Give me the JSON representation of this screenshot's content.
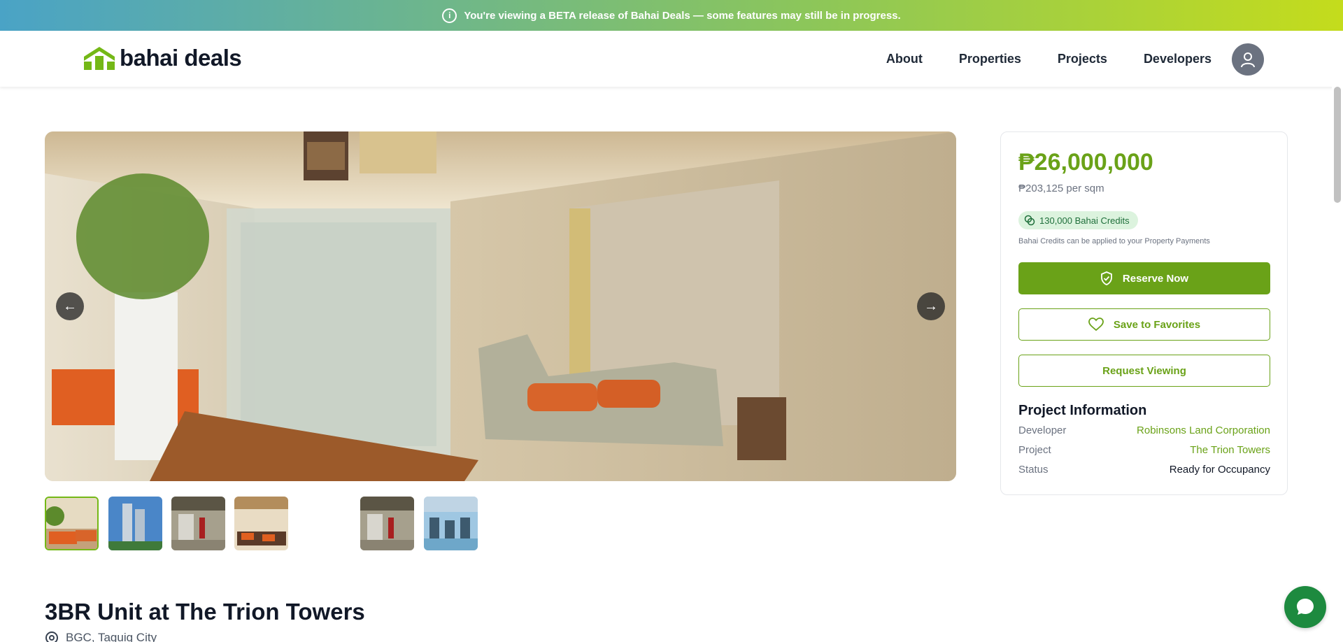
{
  "banner": {
    "text": "You're viewing a BETA release of Bahai Deals — some features may still be in progress.",
    "icon": "info-icon"
  },
  "brand": {
    "name": "bahai deals",
    "accent": "#6aa218",
    "logo_green": "#74b816"
  },
  "nav": {
    "items": [
      {
        "label": "About"
      },
      {
        "label": "Properties"
      },
      {
        "label": "Projects"
      },
      {
        "label": "Developers"
      }
    ],
    "avatar_icon": "user-icon"
  },
  "gallery": {
    "prev_icon": "arrow-left-icon",
    "next_icon": "arrow-right-icon",
    "thumbnail_count": 6,
    "active_thumbnail": 1
  },
  "listing": {
    "title": "3BR Unit at The Trion Towers",
    "location": "BGC, Taguig City"
  },
  "pricing": {
    "price": "₱26,000,000",
    "per_sqm": "₱203,125 per sqm",
    "credits": "130,000 Bahai Credits",
    "credits_note": "Bahai Credits can be applied to your Property Payments"
  },
  "actions": {
    "reserve": "Reserve Now",
    "save": "Save to Favorites",
    "viewing": "Request Viewing"
  },
  "project_info": {
    "heading": "Project Information",
    "rows": [
      {
        "label": "Developer",
        "value": "Robinsons Land Corporation"
      },
      {
        "label": "Project",
        "value": "The Trion Towers"
      },
      {
        "label": "Status",
        "value": "Ready for Occupancy"
      }
    ]
  },
  "chat": {
    "icon": "chat-bubble-icon"
  }
}
